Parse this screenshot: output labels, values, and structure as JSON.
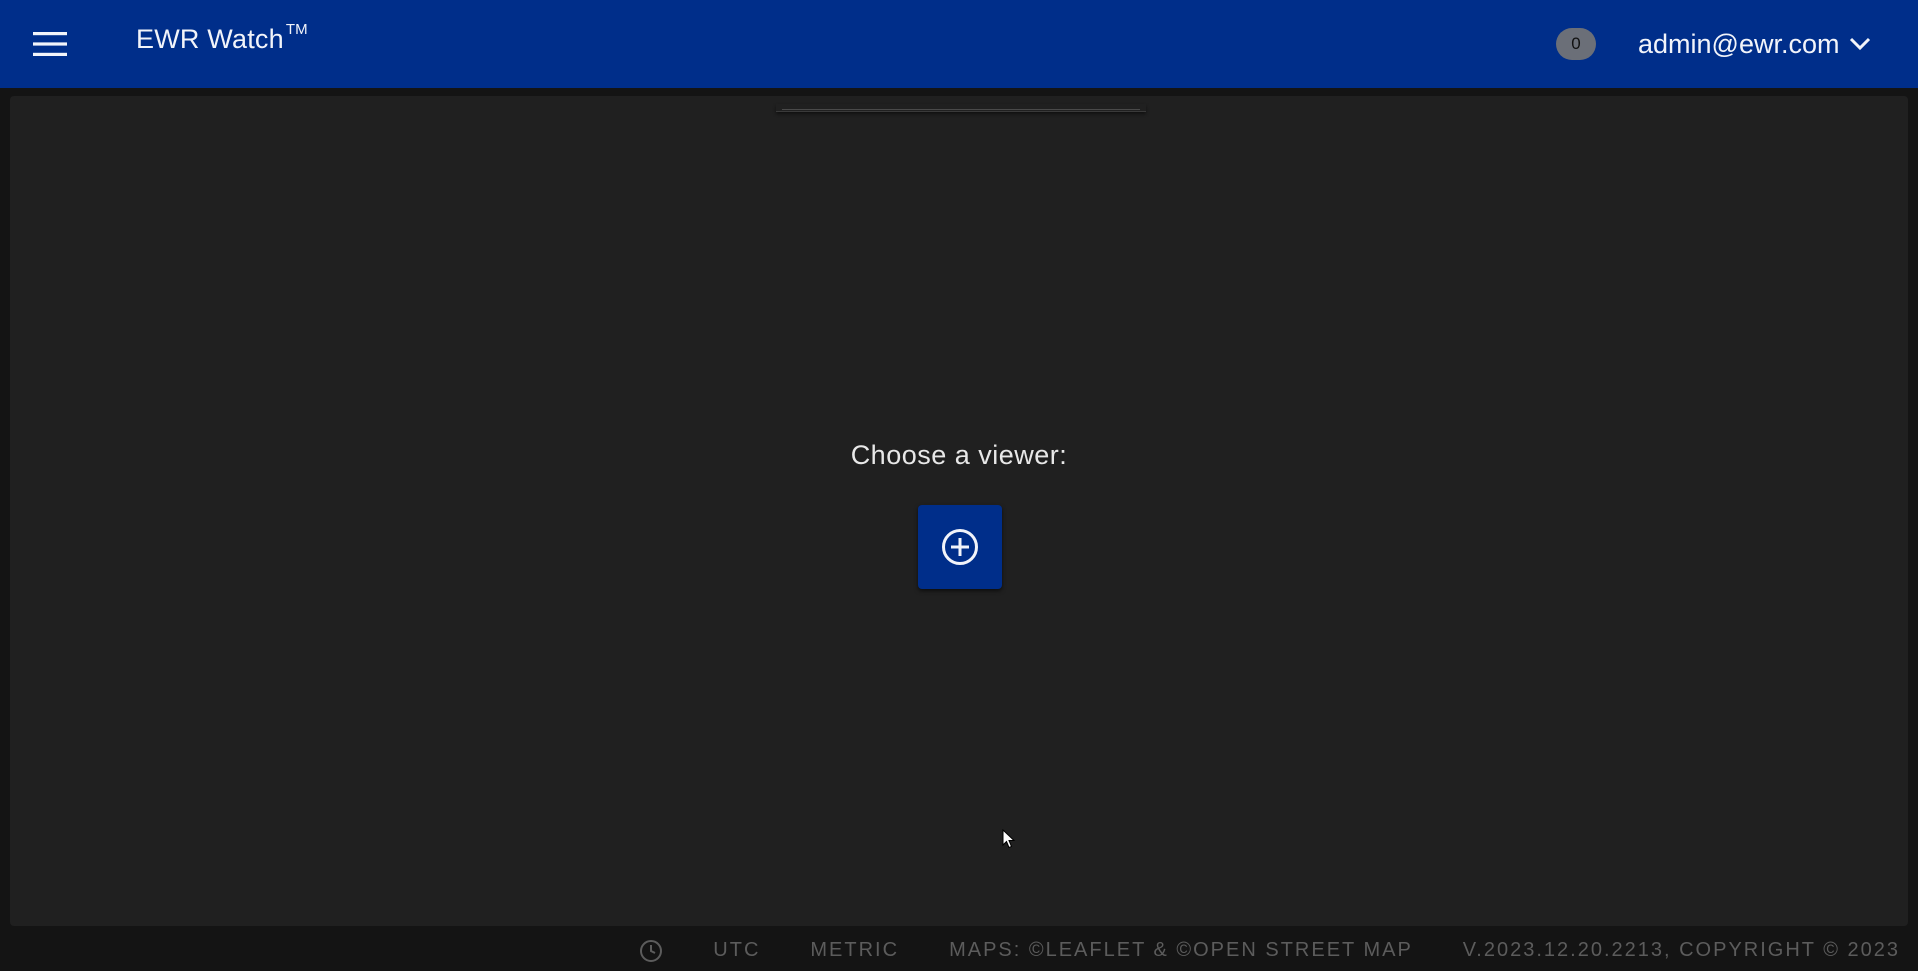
{
  "header": {
    "title": "EWR Watch",
    "title_mark": "TM",
    "notification_count": "0",
    "user_email": "admin@ewr.com"
  },
  "main": {
    "chooser_label": "Choose a viewer:"
  },
  "footer": {
    "timezone": "UTC",
    "units": "METRIC",
    "maps_credit": "MAPS: ©LEAFLET & ©OPEN STREET MAP",
    "version": "V.2023.12.20.2213, COPYRIGHT © 2023"
  },
  "icons": {
    "menu": "hamburger-icon",
    "user_dropdown": "chevron-down-icon",
    "add_viewer": "plus-circle-icon",
    "clock": "clock-icon"
  },
  "colors": {
    "header_bg": "#002e8a",
    "panel_bg": "#202020",
    "page_bg": "#141414",
    "badge_bg": "#6b6f78",
    "footer_text": "#5c5c5c"
  }
}
